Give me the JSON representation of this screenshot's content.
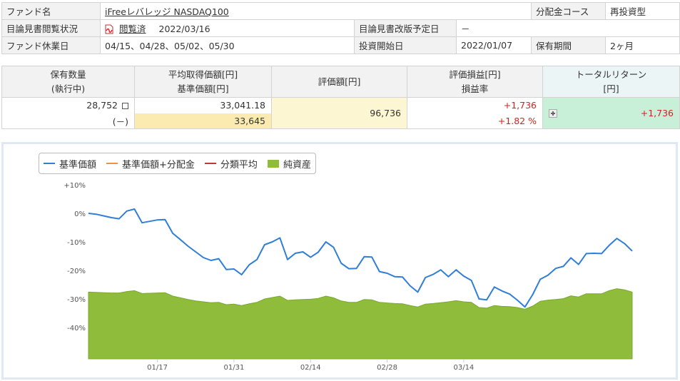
{
  "fund_info": {
    "fund_name_label": "ファンド名",
    "fund_name": "iFreeレバレッジ NASDAQ100",
    "distribution_course_label": "分配金コース",
    "distribution_course": "再投資型",
    "prospectus_status_label": "目論見書閲覧状況",
    "prospectus_status": "閲覧済",
    "prospectus_date": "2022/03/16",
    "revision_label": "目論見書改版予定日",
    "revision_value": "－",
    "holiday_label": "ファンド休業日",
    "holidays": "04/15、04/28、05/02、05/30",
    "start_label": "投資開始日",
    "start_date": "2022/01/07",
    "period_label": "保有期間",
    "period": "2ヶ月"
  },
  "holdings": {
    "headers": {
      "quantity": "保有数量",
      "quantity_sub": "(執行中)",
      "avg_cost": "平均取得価額[円]",
      "nav": "基準価額[円]",
      "valuation": "評価額[円]",
      "pnl": "評価損益[円]",
      "pnl_rate": "損益率",
      "total_return": "トータルリターン",
      "total_return_unit": "[円]"
    },
    "quantity": "28,752",
    "quantity_unit": "口",
    "quantity_pending": "(－)",
    "avg_cost": "33,041.18",
    "nav": "33,645",
    "valuation": "96,736",
    "pnl": "+1,736",
    "pnl_rate": "+1.82 %",
    "total_return": "+1,736"
  },
  "chart_data": {
    "type": "line",
    "legend": [
      "基準価額",
      "基準価額+分配金",
      "分類平均",
      "純資産"
    ],
    "colors": {
      "nav": "#2f7ed8",
      "nav_plus_dist": "#f28f43",
      "category_avg": "#c0392b",
      "net_assets": "#8fbc3b"
    },
    "y_ticks": [
      "+10%",
      "0%",
      "-10%",
      "-20%",
      "-30%",
      "-40%"
    ],
    "y_tick_values": [
      10,
      0,
      -10,
      -20,
      -30,
      -40
    ],
    "ylim": [
      -51,
      10
    ],
    "x_ticks": [
      "01/17",
      "01/31",
      "02/14",
      "02/28",
      "03/14"
    ],
    "x_tick_index": [
      9,
      19,
      29,
      39,
      49
    ],
    "legend_position": "top-left",
    "grid": false,
    "series": [
      {
        "name": "基準価額",
        "values": [
          0.0,
          -0.3,
          -0.9,
          -1.5,
          -1.9,
          0.8,
          1.5,
          -3.3,
          -2.8,
          -2.3,
          -2.2,
          -7.0,
          -9.2,
          -11.5,
          -13.5,
          -15.5,
          -16.5,
          -15.9,
          -19.7,
          -19.5,
          -21.5,
          -18.0,
          -16.2,
          -11.0,
          -10.0,
          -8.6,
          -16.2,
          -14.0,
          -13.5,
          -15.4,
          -13.6,
          -10.0,
          -11.9,
          -17.5,
          -19.4,
          -19.3,
          -15.2,
          -15.3,
          -20.4,
          -21.0,
          -22.2,
          -22.3,
          -25.4,
          -27.6,
          -22.5,
          -21.4,
          -19.8,
          -22.2,
          -19.8,
          -22.0,
          -23.5,
          -30.0,
          -30.3,
          -25.8,
          -27.2,
          -28.3,
          -30.4,
          -32.8,
          -28.5,
          -23.1,
          -21.7,
          -19.3,
          -18.6,
          -15.6,
          -17.9,
          -14.1,
          -14.0,
          -14.1,
          -11.2,
          -8.8,
          -10.6,
          -13.2
        ]
      },
      {
        "name": "純資産",
        "values": [
          -27.6,
          -27.7,
          -27.8,
          -27.9,
          -27.9,
          -27.4,
          -27.1,
          -28.1,
          -28.0,
          -27.9,
          -27.8,
          -29.0,
          -29.6,
          -30.2,
          -30.7,
          -31.0,
          -31.3,
          -31.2,
          -32.0,
          -31.8,
          -32.3,
          -31.7,
          -31.2,
          -30.0,
          -29.5,
          -29.0,
          -30.5,
          -30.3,
          -30.2,
          -30.1,
          -29.8,
          -29.0,
          -29.6,
          -30.7,
          -31.2,
          -31.2,
          -30.2,
          -30.3,
          -31.2,
          -31.4,
          -31.6,
          -31.7,
          -32.3,
          -32.8,
          -31.8,
          -31.6,
          -31.3,
          -31.0,
          -30.6,
          -31.0,
          -31.2,
          -33.0,
          -33.2,
          -32.3,
          -32.6,
          -32.7,
          -33.0,
          -33.6,
          -32.5,
          -30.8,
          -30.4,
          -30.2,
          -29.9,
          -28.9,
          -29.3,
          -28.2,
          -28.2,
          -28.2,
          -27.1,
          -26.4,
          -26.8,
          -27.6
        ]
      }
    ]
  }
}
